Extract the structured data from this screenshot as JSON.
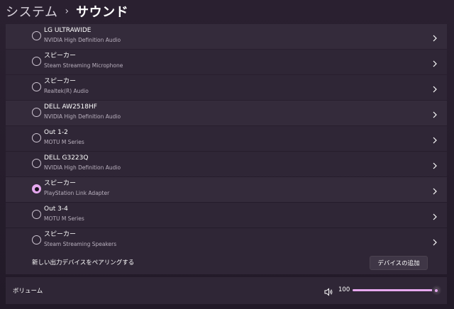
{
  "breadcrumb": {
    "parent": "システム",
    "separator": "›",
    "current": "サウンド"
  },
  "devices": [
    {
      "name": "LG ULTRAWIDE",
      "sub": "NVIDIA High Definition Audio",
      "selected": false
    },
    {
      "name": "スピーカー",
      "sub": "Steam Streaming Microphone",
      "selected": false
    },
    {
      "name": "スピーカー",
      "sub": "Realtek(R) Audio",
      "selected": false
    },
    {
      "name": "DELL AW2518HF",
      "sub": "NVIDIA High Definition Audio",
      "selected": false
    },
    {
      "name": "Out 1-2",
      "sub": "MOTU M Series",
      "selected": false
    },
    {
      "name": "DELL G3223Q",
      "sub": "NVIDIA High Definition Audio",
      "selected": false
    },
    {
      "name": "スピーカー",
      "sub": "PlayStation Link Adapter",
      "selected": true
    },
    {
      "name": "Out 3-4",
      "sub": "MOTU M Series",
      "selected": false
    },
    {
      "name": "スピーカー",
      "sub": "Steam Streaming Speakers",
      "selected": false
    }
  ],
  "pairing": {
    "label": "新しい出力デバイスをペアリングする",
    "button_label": "デバイスの追加"
  },
  "volume": {
    "label": "ボリューム",
    "value": "100",
    "level_percent": 100,
    "icon": "speaker-icon"
  },
  "colors": {
    "accent": "#e6a8ef",
    "background": "#241b2a",
    "row": "#2f2636"
  }
}
